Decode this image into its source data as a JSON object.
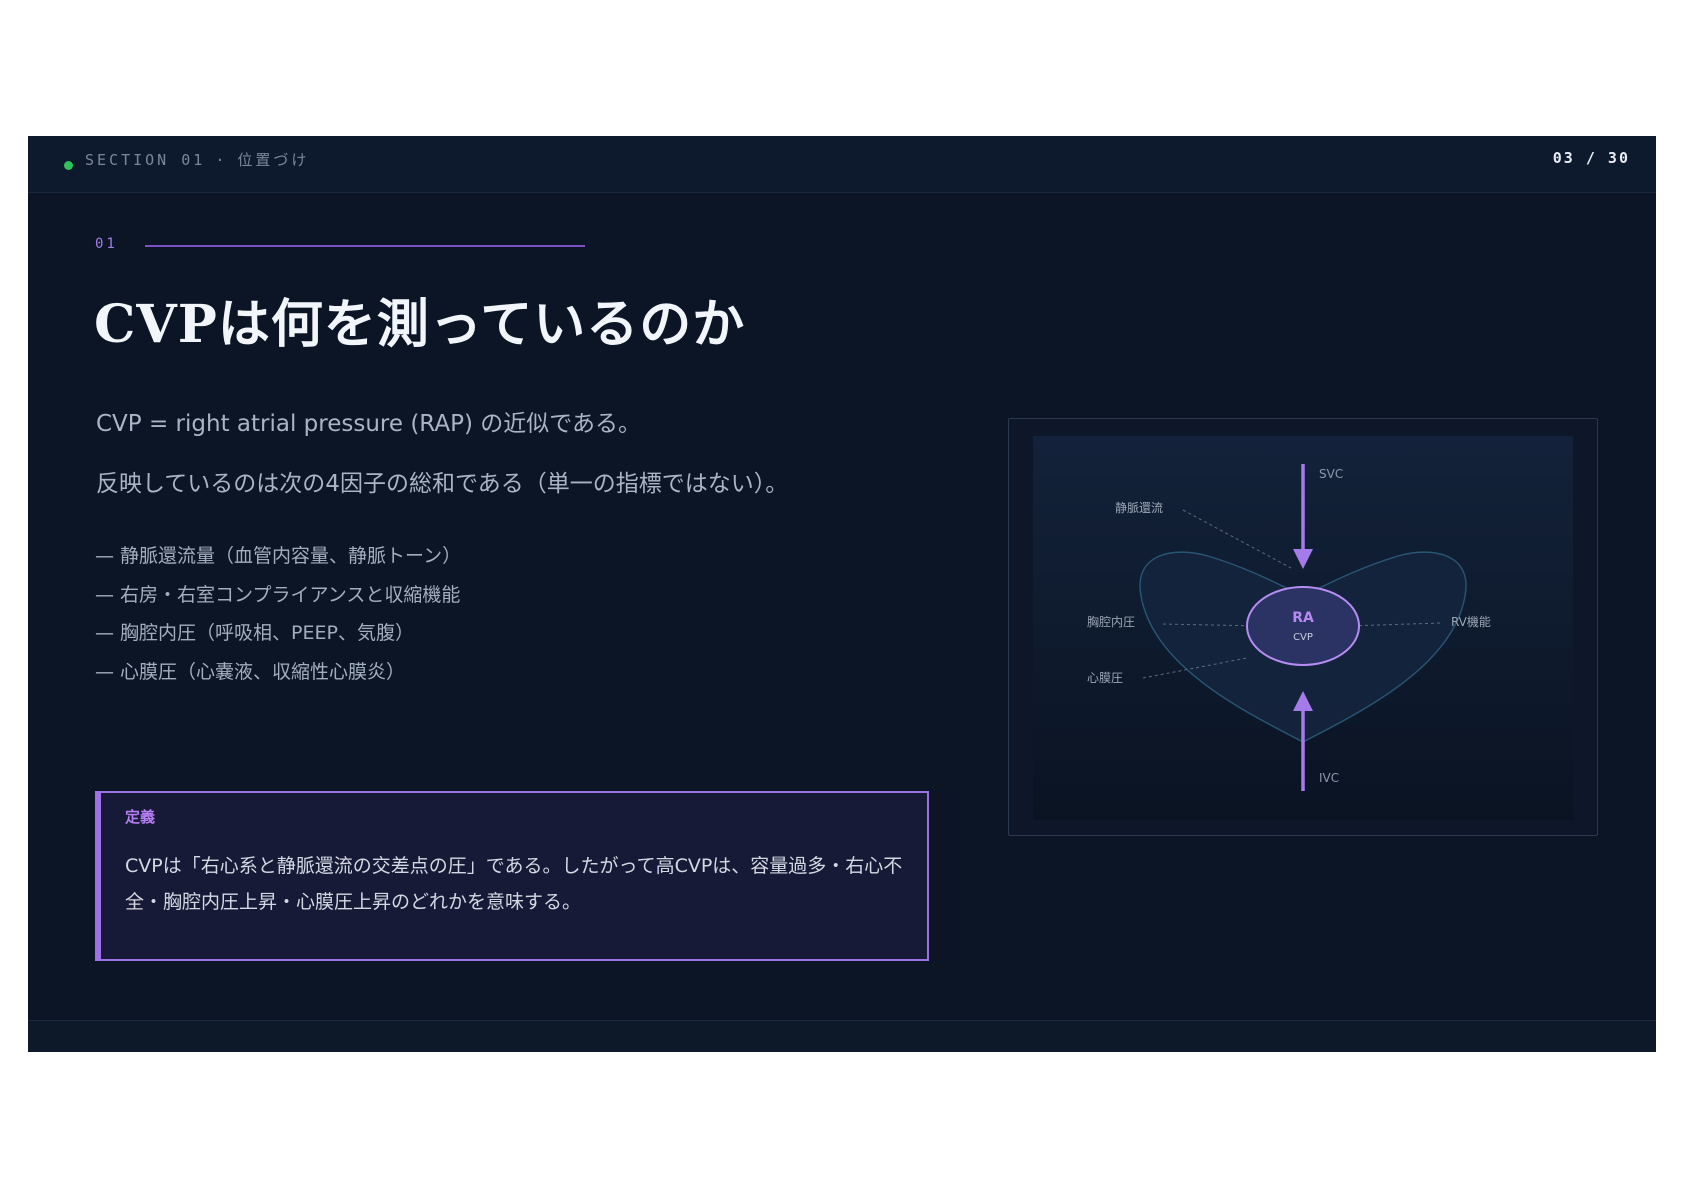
{
  "header": {
    "section_label": "SECTION 01",
    "separator": "·",
    "section_title": "位置づけ",
    "page_indicator": "03 / 30"
  },
  "slide": {
    "kicker": "01",
    "title": "CVPは何を測っているのか",
    "lead1": "CVP = right atrial pressure (RAP) の近似である。",
    "lead2": "反映しているのは次の4因子の総和である（単一の指標ではない）。",
    "factors": [
      "— 静脈還流量（血管内容量、静脈トーン）",
      "— 右房・右室コンプライアンスと収縮機能",
      "— 胸腔内圧（呼吸相、PEEP、気腹）",
      "— 心膜圧（心嚢液、収縮性心膜炎）"
    ],
    "definition": {
      "label": "定義",
      "text": "CVPは「右心系と静脈還流の交差点の圧」である。したがって高CVPは、容量過多・右心不全・胸腔内圧上昇・心膜圧上昇のどれかを意味する。"
    }
  },
  "diagram": {
    "svc": "SVC",
    "ivc": "IVC",
    "ra_title": "RA",
    "ra_sub": "CVP",
    "venous_return": "静脈還流",
    "intrathoracic": "胸腔内圧",
    "rv_function": "RV機能",
    "pericardial": "心膜圧",
    "colors": {
      "accent": "#a57bea",
      "heart_fill": "#15243d",
      "heart_stroke": "#2a5a78"
    }
  }
}
